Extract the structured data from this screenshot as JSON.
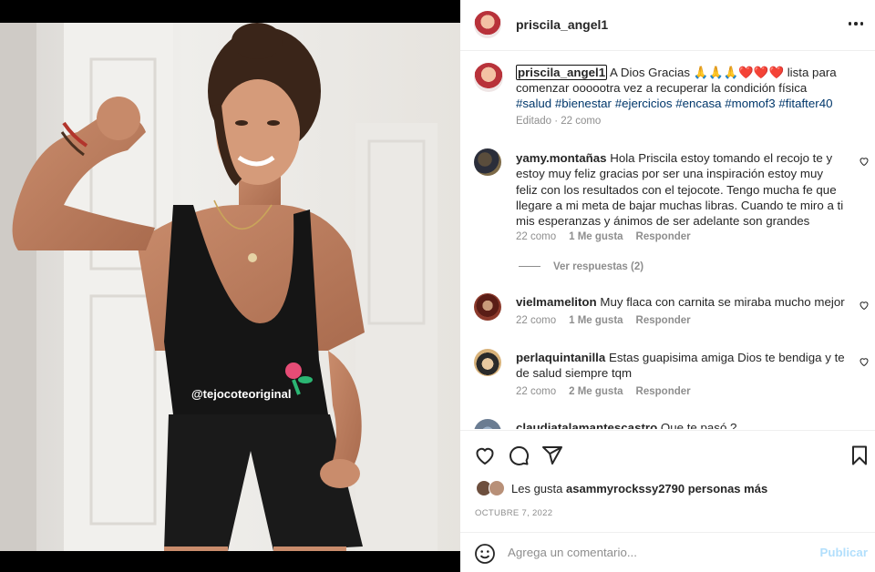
{
  "post": {
    "username": "priscila_angel1",
    "caption_user": "priscila_angel1",
    "caption_text_1": " A Dios Gracias 🙏🙏🙏❤️❤️❤️ lista para comenzar oooootra vez a recuperar la condición física ",
    "tags": [
      "#salud",
      "#bienestar",
      "#ejercicios",
      "#encasa",
      "#momof3",
      "#fitafter40"
    ],
    "caption_meta": "Editado · 22 como",
    "shirt_text": "@tejocoteoriginal"
  },
  "comments": [
    {
      "user": "yamy.montañas",
      "text": " Hola Priscila estoy tomando el recojo te y estoy muy feliz gracias por ser una inspiración estoy muy feliz con los resultados con el tejocote. Tengo mucha fe que llegare a mi meta de bajar muchas libras. Cuando te miro a ti mis esperanzas y ánimos de ser adelante son grandes",
      "time": "22 como",
      "likes": "1 Me gusta",
      "reply": "Responder",
      "view_replies": "Ver respuestas (2)"
    },
    {
      "user": "vielmameliton",
      "text": " Muy flaca con carnita se miraba mucho mejor",
      "time": "22 como",
      "likes": "1 Me gusta",
      "reply": "Responder"
    },
    {
      "user": "perlaquintanilla",
      "text": " Estas guapisima amiga Dios te bendiga y te de salud siempre tqm",
      "time": "22 como",
      "likes": "2 Me gusta",
      "reply": "Responder"
    },
    {
      "user": "claudiatalamantescastro",
      "text": " Que te pasó ?"
    }
  ],
  "likes": {
    "prefix": "Les gusta ",
    "user": "asammyrockssy",
    "count": "2790 personas más"
  },
  "date": "OCTUBRE 7, 2022",
  "comment_box": {
    "placeholder": "Agrega un comentario...",
    "publish": "Publicar"
  },
  "icons": {
    "like": "heart-icon",
    "comment": "comment-icon",
    "share": "paper-plane-icon",
    "save": "bookmark-icon",
    "emoji": "smiley-icon",
    "more": "more-horizontal-icon"
  },
  "colors": {
    "link": "#00376b",
    "muted": "#8e8e8e",
    "publish": "#b2dffc",
    "text": "#262626"
  }
}
